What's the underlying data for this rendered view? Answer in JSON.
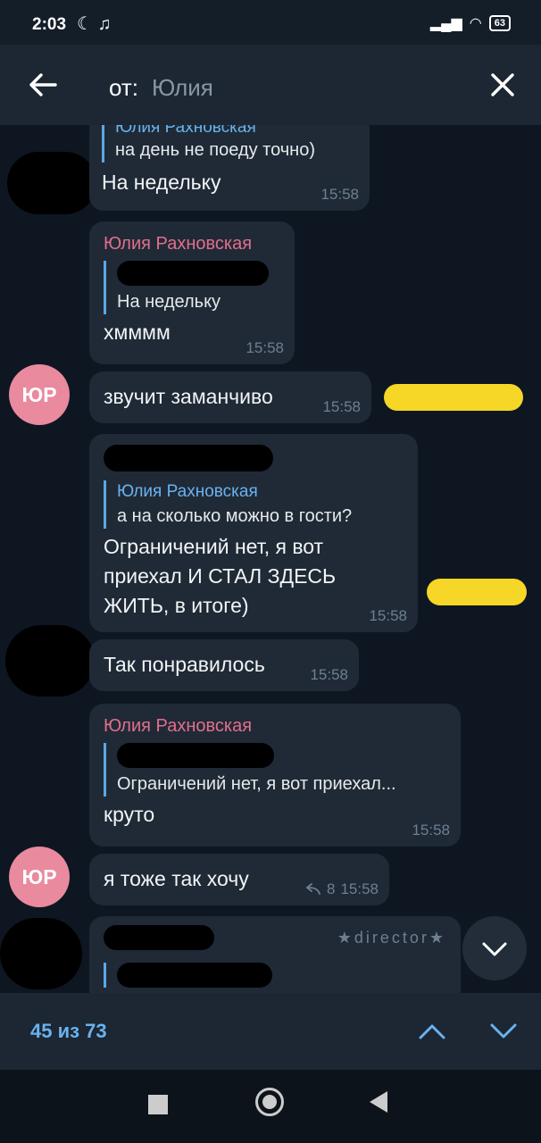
{
  "status_bar": {
    "time": "2:03",
    "left_icons": "☾ ♫",
    "signal": "▂▄▆",
    "wifi": "◠",
    "battery": "63"
  },
  "search": {
    "prefix": "от:",
    "value": "Юлия"
  },
  "messages": {
    "m1": {
      "reply_name": "Юлия Рахновская",
      "reply_text": "на день не поеду точно)",
      "text": "На недельку",
      "time": "15:58"
    },
    "m2": {
      "sender": "Юлия Рахновская",
      "reply_text": "На недельку",
      "text": "хмммм",
      "time": "15:58"
    },
    "m3": {
      "avatar": "ЮР",
      "text": "звучит заманчиво",
      "time": "15:58"
    },
    "m4": {
      "reply_name": "Юлия Рахновская",
      "reply_text": "а на сколько можно в гости?",
      "text_lines": [
        "Ограничений нет, я вот",
        "приехал И СТАЛ ЗДЕСЬ",
        "ЖИТЬ, в итоге)"
      ],
      "time": "15:58"
    },
    "m5": {
      "text": "Так понравилось",
      "time": "15:58"
    },
    "m6": {
      "sender": "Юлия Рахновская",
      "reply_text": "Ограничений нет, я вот приехал...",
      "text": "круто",
      "time": "15:58"
    },
    "m7": {
      "avatar": "ЮР",
      "text": "я тоже так хочу",
      "replies": "8",
      "time": "15:58"
    },
    "m8": {
      "badge": "★director★"
    }
  },
  "bottom": {
    "counter": "45 из 73"
  },
  "colors": {
    "accent": "#6ab2ef",
    "sender_pink": "#e36e8d",
    "avatar": "#e98a9f",
    "bubble": "#1f2a36",
    "background": "#0e1621"
  }
}
